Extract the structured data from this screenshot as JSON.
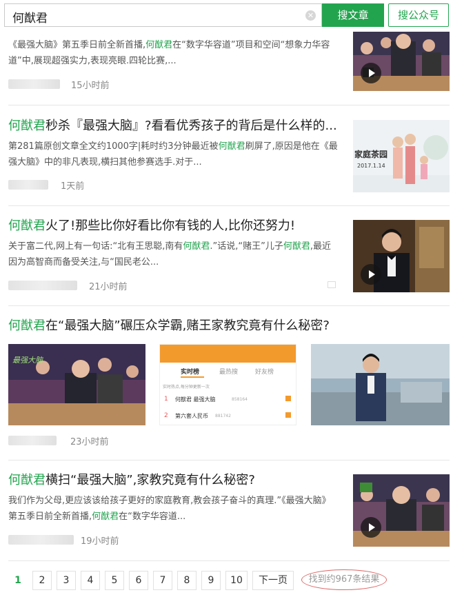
{
  "search": {
    "query": "何猷君",
    "article_button": "搜文章",
    "account_button": "搜公众号"
  },
  "results": [
    {
      "desc_parts": [
        "《最强大脑》第五季日前全新首播,",
        "何猷君",
        "在“数字华容道”项目和空间“想象力华容道”中,展现超强实力,表现亮眼.四轮比赛,..."
      ],
      "time": "15小时前"
    },
    {
      "title_parts": [
        "何猷君",
        "秒杀『最强大脑』?看看优秀孩子的背后是什么样的..."
      ],
      "desc_parts": [
        "第281篇原创文章全文约1000字|耗时约3分钟最近被",
        "何猷君",
        "刷屏了,原因是他在《最强大脑》中的非凡表现,横扫其他参赛选手.对于..."
      ],
      "time": "1天前",
      "thumb_text": "家庭茶园",
      "thumb_date": "2017.1.14"
    },
    {
      "title_parts": [
        "何猷君",
        "火了!那些比你好看比你有钱的人,比你还努力!"
      ],
      "desc_parts": [
        "关于富二代,网上有一句话:“北有王思聪,南有",
        "何猷君",
        ".”话说,“赌王”儿子",
        "何猷君",
        ",最近因为高智商而备受关注,与“国民老公..."
      ],
      "time": "21小时前"
    },
    {
      "title_parts": [
        "何猷君",
        "在“最强大脑”碾压众学霸,赌王家教究竟有什么秘密?"
      ],
      "time": "23小时前",
      "img1_text": "最强大脑",
      "ranking": {
        "tabs": [
          "实时榜",
          "最热搜",
          "好友榜"
        ],
        "sub": "实时热点,每分钟更新一次",
        "rows": [
          {
            "rank": "1",
            "name": "何猷君 最强大脑",
            "count": "858164"
          },
          {
            "rank": "2",
            "name": "第六套人民币",
            "count": "881742"
          }
        ]
      }
    },
    {
      "title_parts": [
        "何猷君",
        "横扫“最强大脑”,家教究竟有什么秘密?"
      ],
      "desc_parts": [
        "我们作为父母,更应该该给孩子更好的家庭教育,教会孩子奋斗的真理.”《最强大脑》第五季日前全新首播,",
        "何猷君",
        "在“数字华容道..."
      ],
      "time": "19小时前"
    }
  ],
  "pagination": {
    "pages": [
      "1",
      "2",
      "3",
      "4",
      "5",
      "6",
      "7",
      "8",
      "9",
      "10"
    ],
    "next": "下一页",
    "result_count": "找到约967条结果"
  },
  "colors": {
    "brand_green": "#22a44e",
    "highlight": "#22a44e",
    "circle_annotation": "#d66666"
  }
}
